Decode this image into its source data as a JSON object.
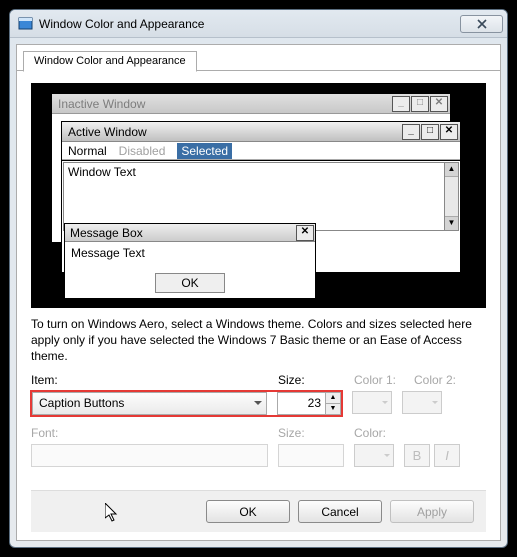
{
  "window": {
    "title": "Window Color and Appearance"
  },
  "tab": {
    "label": "Window Color and Appearance"
  },
  "preview": {
    "inactive_title": "Inactive Window",
    "active_title": "Active Window",
    "menu_normal": "Normal",
    "menu_disabled": "Disabled",
    "menu_selected": "Selected",
    "window_text": "Window Text",
    "msgbox_title": "Message Box",
    "msgbox_text": "Message Text",
    "msgbox_ok": "OK"
  },
  "description": "To turn on Windows Aero, select a Windows theme.  Colors and sizes selected here apply only if you have selected the Windows 7 Basic theme or an Ease of Access theme.",
  "labels": {
    "item": "Item:",
    "size": "Size:",
    "color1": "Color 1:",
    "color2": "Color 2:",
    "font": "Font:",
    "fsize": "Size:",
    "fcolor": "Color:"
  },
  "item": {
    "selected": "Caption Buttons",
    "size": "23"
  },
  "buttons": {
    "ok": "OK",
    "cancel": "Cancel",
    "apply": "Apply",
    "bold": "B",
    "italic": "I"
  }
}
